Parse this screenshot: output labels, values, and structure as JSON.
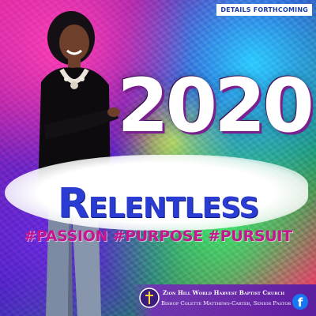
{
  "badge": {
    "text": "DETAILS FORTHCOMING"
  },
  "poster": {
    "year": "2020",
    "title": "Relentless",
    "hashtags": "#PASSION #PURPOSE #PURSUIT"
  },
  "footer": {
    "church_name": "Zion Hill World Harvest Baptist Church",
    "pastor": "Bishop Colette Matthews-Carter, Senior Pastor",
    "facebook_glyph": "f"
  },
  "colors": {
    "title": "#2b3cd3",
    "hashtags": "#c6158f",
    "badge_text": "#1b3fa6",
    "footer_bg": "#5b1fa0",
    "facebook": "#1877f2"
  },
  "icons": [
    "church-logo-icon",
    "facebook-icon"
  ]
}
